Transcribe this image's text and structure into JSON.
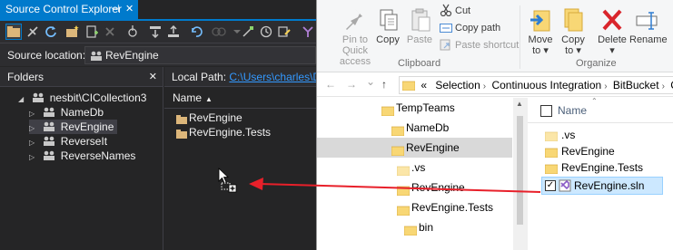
{
  "vs": {
    "title": "Source Control Explorer",
    "pin_glyph": "⊣",
    "close_glyph": "✕",
    "source_location_label": "Source location:",
    "source_location_value": "RevEngine",
    "folders_header": "Folders",
    "tree": [
      {
        "label": "nesbit\\CICollection3",
        "expander": "◢"
      },
      {
        "label": "NameDb",
        "expander": "▷"
      },
      {
        "label": "RevEngine",
        "expander": "▷",
        "selected": true
      },
      {
        "label": "ReverseIt",
        "expander": "▷"
      },
      {
        "label": "ReverseNames",
        "expander": "▷"
      }
    ],
    "local_path_label": "Local Path:",
    "local_path_value": "C:\\Users\\charles\\Doc",
    "column_name": "Name",
    "sort_glyph": "▲",
    "files": [
      "RevEngine",
      "RevEngine.Tests"
    ]
  },
  "fe": {
    "ribbon": {
      "pin_label": "Pin to Quick access",
      "copy_label": "Copy",
      "paste_label": "Paste",
      "cut_label": "Cut",
      "copy_path_label": "Copy path",
      "paste_shortcut_label": "Paste shortcut",
      "clipboard_group": "Clipboard",
      "move_to_label": "Move to",
      "copy_to_label": "Copy to",
      "delete_label": "Delete",
      "rename_label": "Rename",
      "organize_group": "Organize"
    },
    "nav": {
      "back": "←",
      "forward": "→",
      "recent": "⌄",
      "up": "↑"
    },
    "address": {
      "prefix": "«",
      "segments": [
        "Selection",
        "Continuous Integration",
        "BitBucket",
        "CI"
      ]
    },
    "tree": [
      {
        "label": "TempTeams"
      },
      {
        "label": "NameDb"
      },
      {
        "label": "RevEngine",
        "selected": true
      },
      {
        "label": ".vs"
      },
      {
        "label": "RevEngine"
      },
      {
        "label": "RevEngine.Tests"
      },
      {
        "label": "bin"
      }
    ],
    "column_name": "Name",
    "sort_glyph": "⌃",
    "files": [
      ".vs",
      "RevEngine",
      "RevEngine.Tests"
    ],
    "selected_file": "RevEngine.sln",
    "selected_check": "✓"
  },
  "colors": {
    "vs_accent": "#007acc",
    "drag_arrow": "#e8202a",
    "folder": "#f0c355",
    "selection": "#cce8ff"
  }
}
